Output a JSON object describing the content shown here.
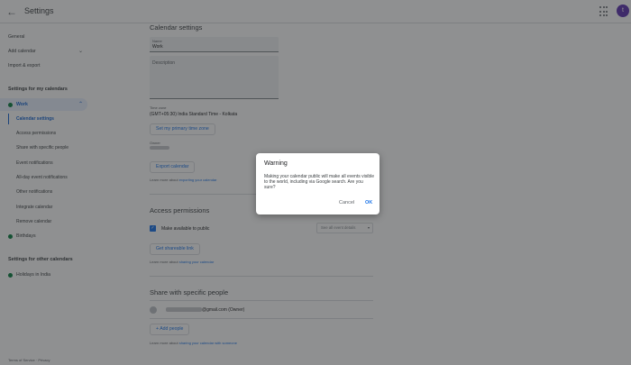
{
  "header": {
    "title": "Settings",
    "back_icon": "arrow-left-icon",
    "apps_icon": "apps-grid-icon",
    "avatar_letter": "t",
    "avatar_color": "#5e35b1"
  },
  "sidebar": {
    "general": "General",
    "add_calendar": "Add calendar",
    "import_export": "Import & export",
    "my_calendars_heading": "Settings for my calendars",
    "work": "Work",
    "work_subitems": [
      "Calendar settings",
      "Access permissions",
      "Share with specific people",
      "Event notifications",
      "All-day event notifications",
      "Other notifications",
      "Integrate calendar",
      "Remove calendar"
    ],
    "birthdays": "Birthdays",
    "other_calendars_heading": "Settings for other calendars",
    "holidays": "Holidays in India",
    "calendar_color": "#0b8043",
    "footer": "Terms of Service · Privacy"
  },
  "main": {
    "calendar_settings_title": "Calendar settings",
    "name_label": "Name",
    "name_value": "Work",
    "description_label": "Description",
    "timezone_label": "Time zone",
    "timezone_value": "(GMT+05:30) India Standard Time - Kolkata",
    "set_primary_tz": "Set my primary time zone",
    "owner_label": "Owner",
    "export_button": "Export calendar",
    "export_learn_prefix": "Learn more about ",
    "export_learn_link": "exporting your calendar",
    "access_title": "Access permissions",
    "make_public": "Make available to public",
    "see_all_details": "See all event details",
    "get_link": "Get shareable link",
    "sharing_learn_prefix": "Learn more about ",
    "sharing_learn_link": "sharing your calendar",
    "share_title": "Share with specific people",
    "owner_email_suffix": "@gmail.com (Owner)",
    "add_people": "Add people",
    "share_someone_prefix": "Learn more about ",
    "share_someone_link": "sharing your calendar with someone"
  },
  "dialog": {
    "title": "Warning",
    "body": "Making your calendar public will make all events visible to the world, including via Google search. Are you sure?",
    "cancel": "Cancel",
    "ok": "OK"
  }
}
